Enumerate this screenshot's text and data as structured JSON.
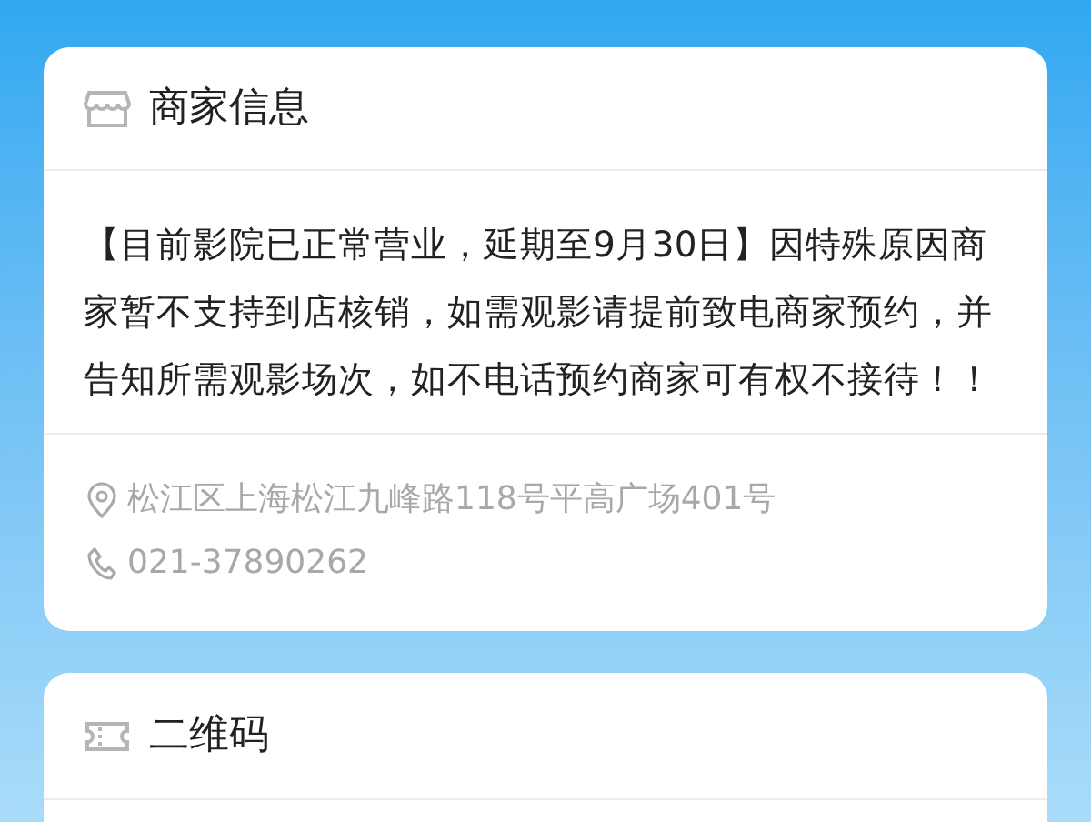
{
  "merchant_card": {
    "title": "商家信息",
    "notice": "【目前影院已正常营业，延期至9月30日】因特殊原因商家暂不支持到店核销，如需观影请提前致电商家预约，并告知所需观影场次，如不电话预约商家可有权不接待！！",
    "address": "松江区上海松江九峰路118号平高广场401号",
    "phone": "021-37890262"
  },
  "qr_card": {
    "title": "二维码"
  }
}
